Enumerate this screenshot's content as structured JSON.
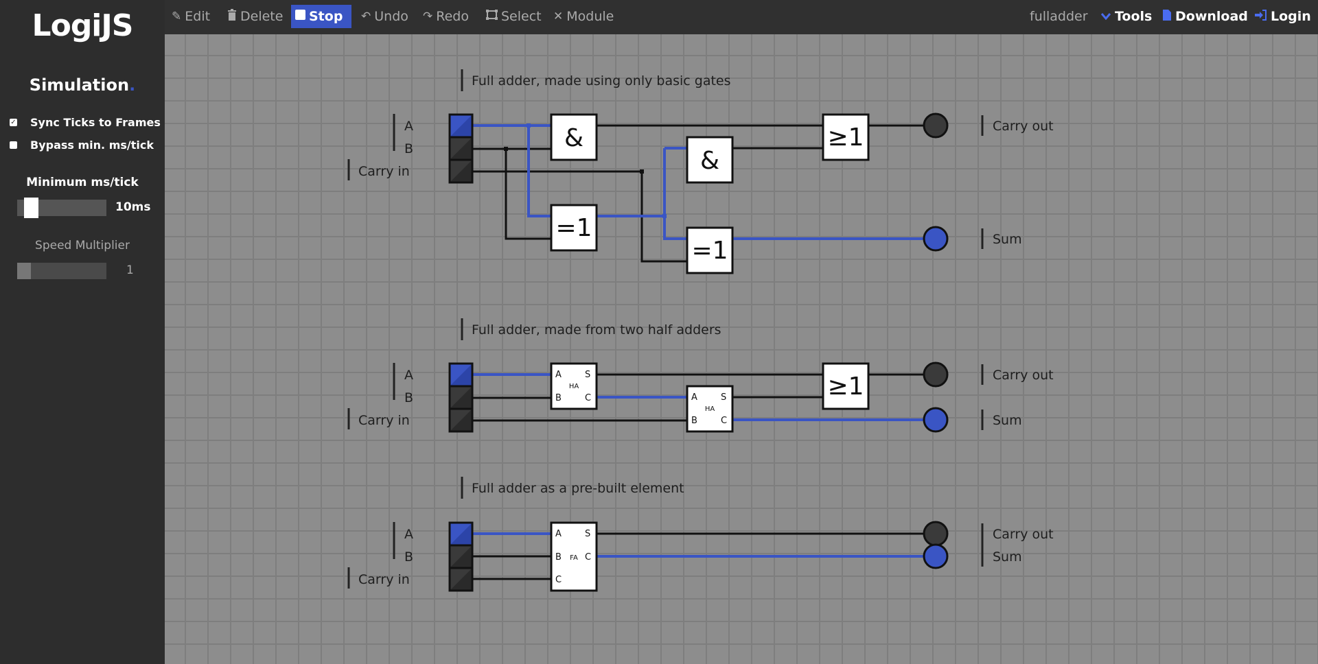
{
  "sidebar": {
    "logo": "LogiJS",
    "section_title": "Simulation",
    "section_title_dot": ".",
    "sync_ticks": {
      "label": "Sync Ticks to Frames",
      "checked": true,
      "check_glyph": "✓"
    },
    "bypass": {
      "label": "Bypass min. ms/tick",
      "checked": false
    },
    "min_ms": {
      "label": "Minimum ms/tick",
      "value": "10ms",
      "level": 0.1
    },
    "speed": {
      "label": "Speed Multiplier",
      "value": "1",
      "level": 0.0
    }
  },
  "toolbar": {
    "edit": {
      "label": "Edit",
      "icon": "pencil-icon"
    },
    "delete": {
      "label": "Delete",
      "icon": "trash-icon"
    },
    "stop": {
      "label": "Stop",
      "icon": "stop-icon"
    },
    "undo": {
      "label": "Undo",
      "icon": "undo-icon"
    },
    "redo": {
      "label": "Redo",
      "icon": "redo-icon"
    },
    "select": {
      "label": "Select",
      "icon": "select-icon"
    },
    "module": {
      "label": "Module",
      "icon": "tools-icon"
    },
    "project_name": "fulladder",
    "tools": {
      "label": "Tools",
      "icon": "chevron-down-icon"
    },
    "download": {
      "label": "Download",
      "icon": "file-icon"
    },
    "login": {
      "label": "Login",
      "icon": "login-icon"
    }
  },
  "colors": {
    "active_wire": "#3a55c4",
    "accent": "#3a55c4",
    "canvas": "#8d8d8d",
    "sidebar": "#2d2d2d"
  },
  "circuit1": {
    "title": "Full adder, made using only basic gates",
    "in_a": "A",
    "in_b": "B",
    "in_cin": "Carry in",
    "and1": "&",
    "and2": "&",
    "xor1": "=1",
    "xor2": "=1",
    "or1": "≥1",
    "out_carry": "Carry out",
    "out_sum": "Sum"
  },
  "circuit2": {
    "title": "Full adder, made from two half adders",
    "in_a": "A",
    "in_b": "B",
    "in_cin": "Carry in",
    "ha_label": "HA",
    "pin_a": "A",
    "pin_b": "B",
    "pin_s": "S",
    "pin_c": "C",
    "or1": "≥1",
    "out_carry": "Carry out",
    "out_sum": "Sum"
  },
  "circuit3": {
    "title": "Full adder as a pre-built element",
    "in_a": "A",
    "in_b": "B",
    "in_cin": "Carry in",
    "fa_label": "FA",
    "pin_a": "A",
    "pin_b": "B",
    "pin_c_in": "C",
    "pin_s": "S",
    "pin_c": "C",
    "out_carry": "Carry out",
    "out_sum": "Sum"
  }
}
